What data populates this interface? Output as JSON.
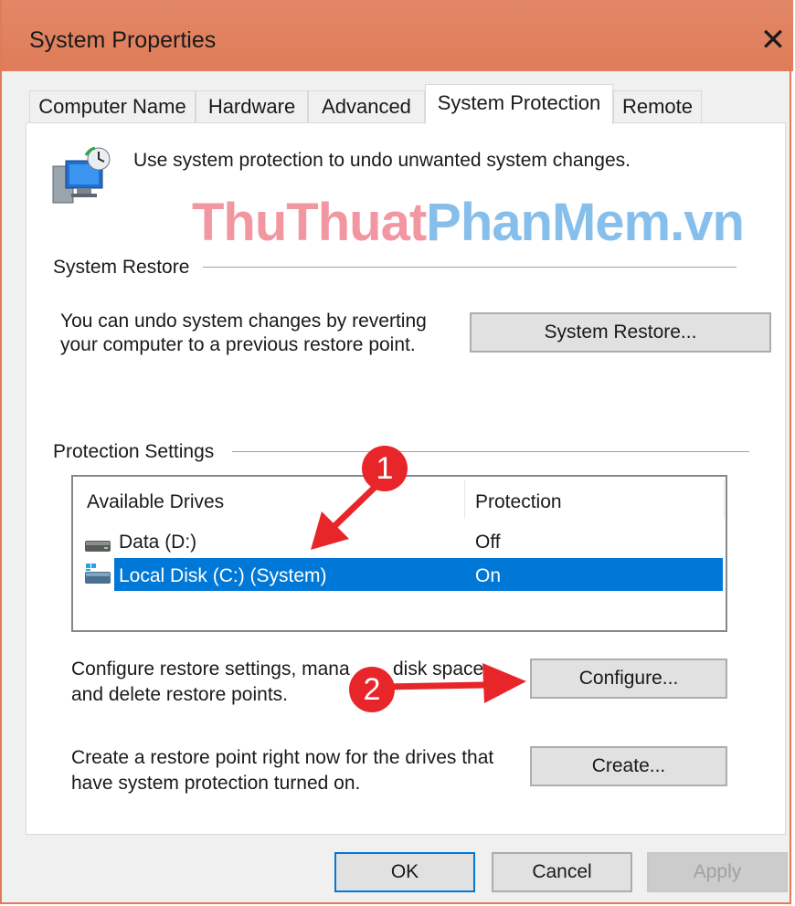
{
  "window": {
    "title": "System Properties",
    "close_glyph": "✕"
  },
  "tabs": [
    {
      "label": "Computer Name"
    },
    {
      "label": "Hardware"
    },
    {
      "label": "Advanced"
    },
    {
      "label": "System Protection",
      "active": true
    },
    {
      "label": "Remote"
    }
  ],
  "intro": {
    "text": "Use system protection to undo unwanted system changes.",
    "icon": "system-protection-icon"
  },
  "watermark": {
    "part1": "ThuThuat",
    "part2": "PhanMem.vn"
  },
  "system_restore": {
    "group_label": "System Restore",
    "description_line1": "You can undo system changes by reverting",
    "description_line2": "your computer to a previous restore point.",
    "button_label": "System Restore..."
  },
  "protection_settings": {
    "group_label": "Protection Settings",
    "columns": [
      "Available Drives",
      "Protection"
    ],
    "drives": [
      {
        "name": "Data (D:)",
        "protection": "Off",
        "icon": "drive-icon",
        "selected": false
      },
      {
        "name": "Local Disk (C:) (System)",
        "protection": "On",
        "icon": "system-drive-icon",
        "selected": true
      }
    ]
  },
  "configure": {
    "description_line1": "Configure restore settings, mana",
    "description_line1b": "disk space",
    "description_line2": "and delete restore points.",
    "button_label": "Configure..."
  },
  "create": {
    "description_line1": "Create a restore point right now for the drives that",
    "description_line2": "have system protection turned on.",
    "button_label": "Create..."
  },
  "footer": {
    "ok_label": "OK",
    "cancel_label": "Cancel",
    "apply_label": "Apply"
  },
  "annotations": {
    "badge1": "1",
    "badge2": "2",
    "color": "#e8262a"
  },
  "colors": {
    "title_bar": "#e07b5a",
    "selection": "#0078d7"
  }
}
